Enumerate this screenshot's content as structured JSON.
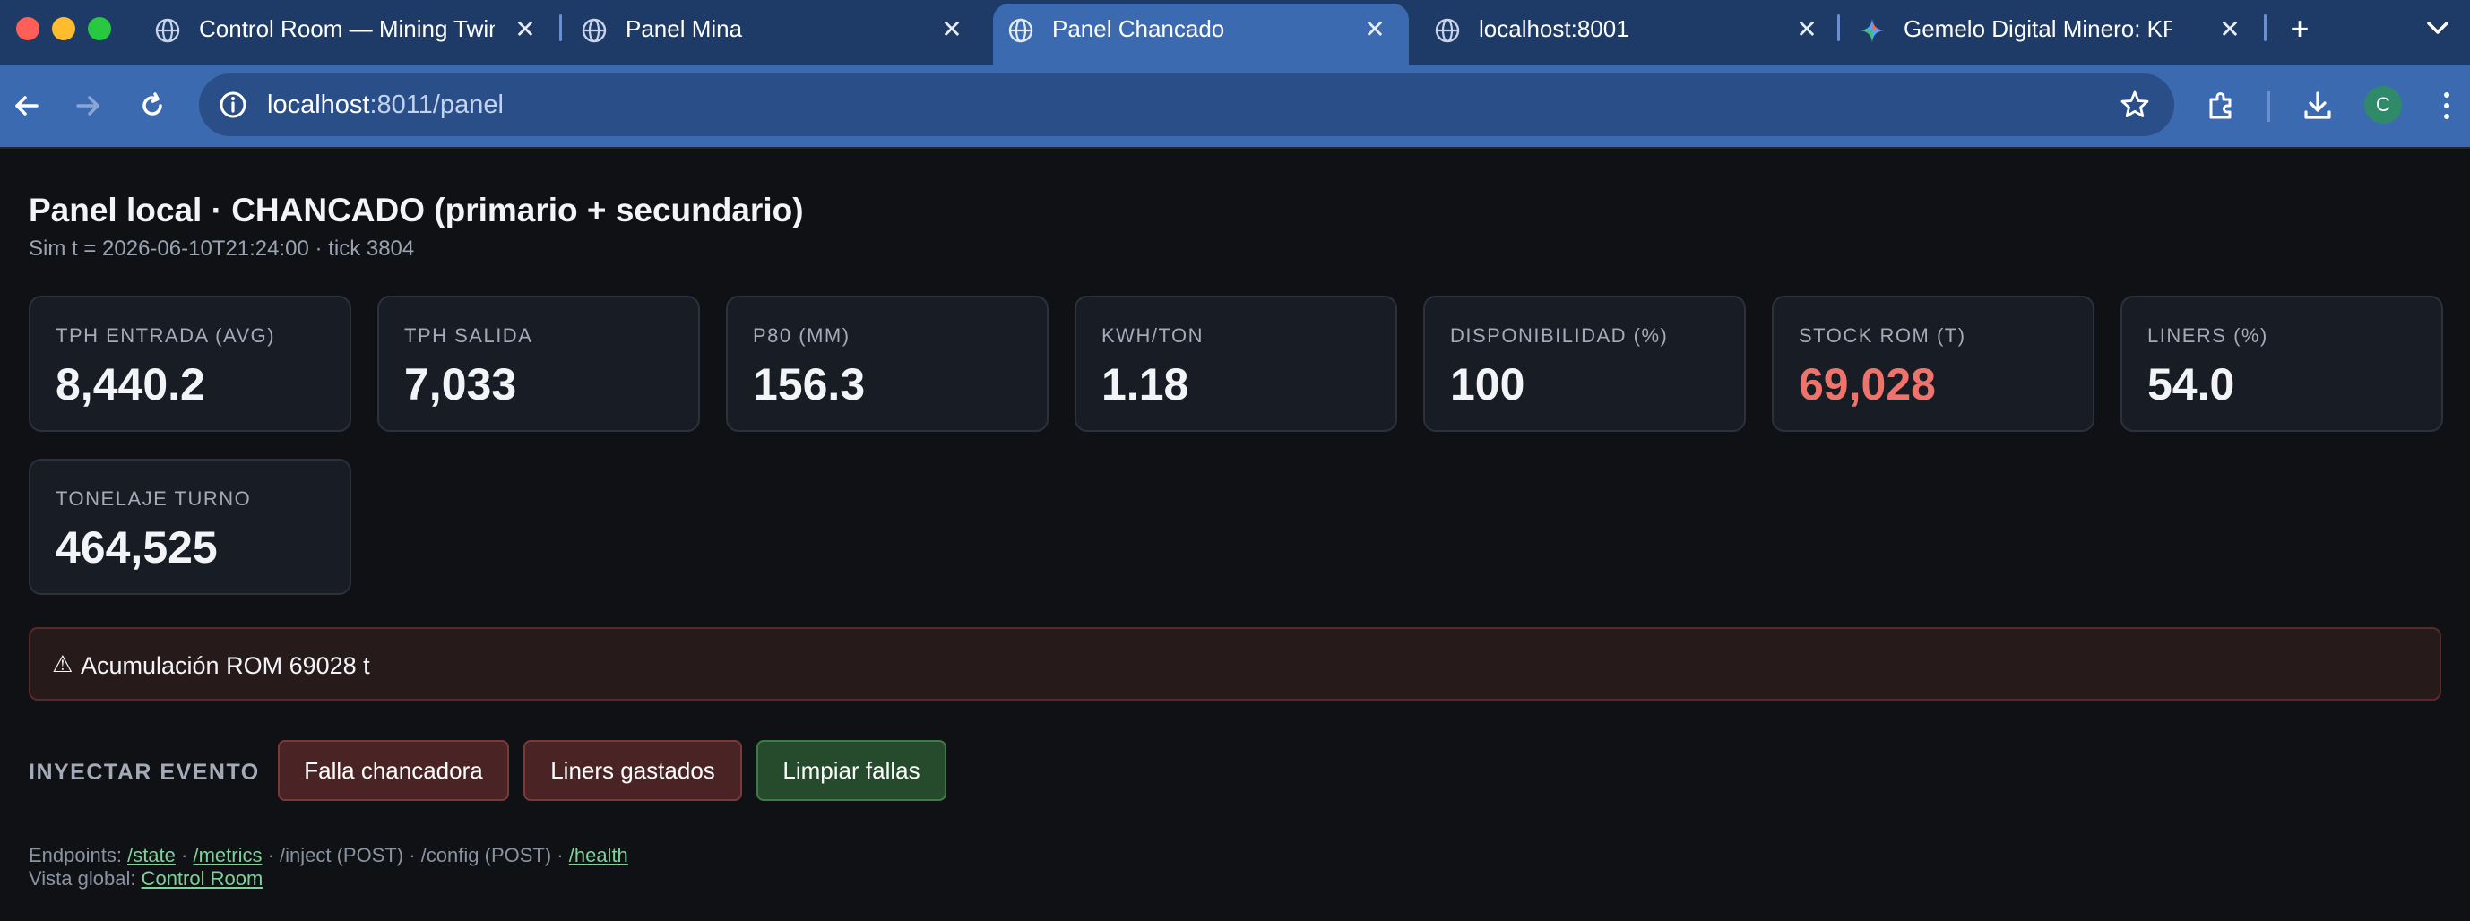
{
  "browser": {
    "tabs": [
      {
        "label": "Control Room — Mining Twin",
        "active": false,
        "icon": "globe-icon"
      },
      {
        "label": "Panel Mina",
        "active": false,
        "icon": "globe-icon"
      },
      {
        "label": "Panel Chancado",
        "active": true,
        "icon": "globe-icon"
      },
      {
        "label": "localhost:8001",
        "active": false,
        "icon": "globe-icon"
      },
      {
        "label": "Gemelo Digital Minero: KPI y D",
        "active": false,
        "icon": "gemini-spark-icon"
      }
    ],
    "close_glyph": "✕",
    "new_tab_glyph": "+",
    "address": {
      "host": "localhost",
      "rest": ":8011/panel"
    },
    "profile_initial": "C",
    "accent": "#3c6ab0"
  },
  "page": {
    "title": "Panel local · CHANCADO (primario + secundario)",
    "subtitle": "Sim t = 2026-06-10T21:24:00 · tick 3804",
    "kpis": [
      {
        "label": "TPH ENTRADA (AVG)",
        "value": "8,440.2",
        "alert": false
      },
      {
        "label": "TPH SALIDA",
        "value": "7,033",
        "alert": false
      },
      {
        "label": "P80 (MM)",
        "value": "156.3",
        "alert": false
      },
      {
        "label": "KWH/TON",
        "value": "1.18",
        "alert": false
      },
      {
        "label": "DISPONIBILIDAD (%)",
        "value": "100",
        "alert": false
      },
      {
        "label": "STOCK ROM (T)",
        "value": "69,028",
        "alert": true
      },
      {
        "label": "LINERS (%)",
        "value": "54.0",
        "alert": false
      },
      {
        "label": "TONELAJE TURNO",
        "value": "464,525",
        "alert": false
      }
    ],
    "alert": {
      "icon": "⚠",
      "text": "Acumulación ROM 69028 t"
    },
    "inject": {
      "label": "INYECTAR EVENTO",
      "buttons": [
        {
          "label": "Falla chancadora",
          "style": "danger"
        },
        {
          "label": "Liners gastados",
          "style": "danger"
        },
        {
          "label": "Limpiar fallas",
          "style": "success"
        }
      ]
    },
    "footer": {
      "endpoints_prefix": "Endpoints: ",
      "state": "/state",
      "sep1": " · ",
      "metrics": "/metrics",
      "middle": " · /inject (POST) · /config (POST) · ",
      "health": "/health",
      "vista_prefix": "Vista global: ",
      "control_room": "Control Room"
    },
    "colors": {
      "alert_value": "#f0736b",
      "link": "#7fd29a",
      "danger_bg": "#4a2424",
      "success_bg": "#264a2c"
    }
  }
}
